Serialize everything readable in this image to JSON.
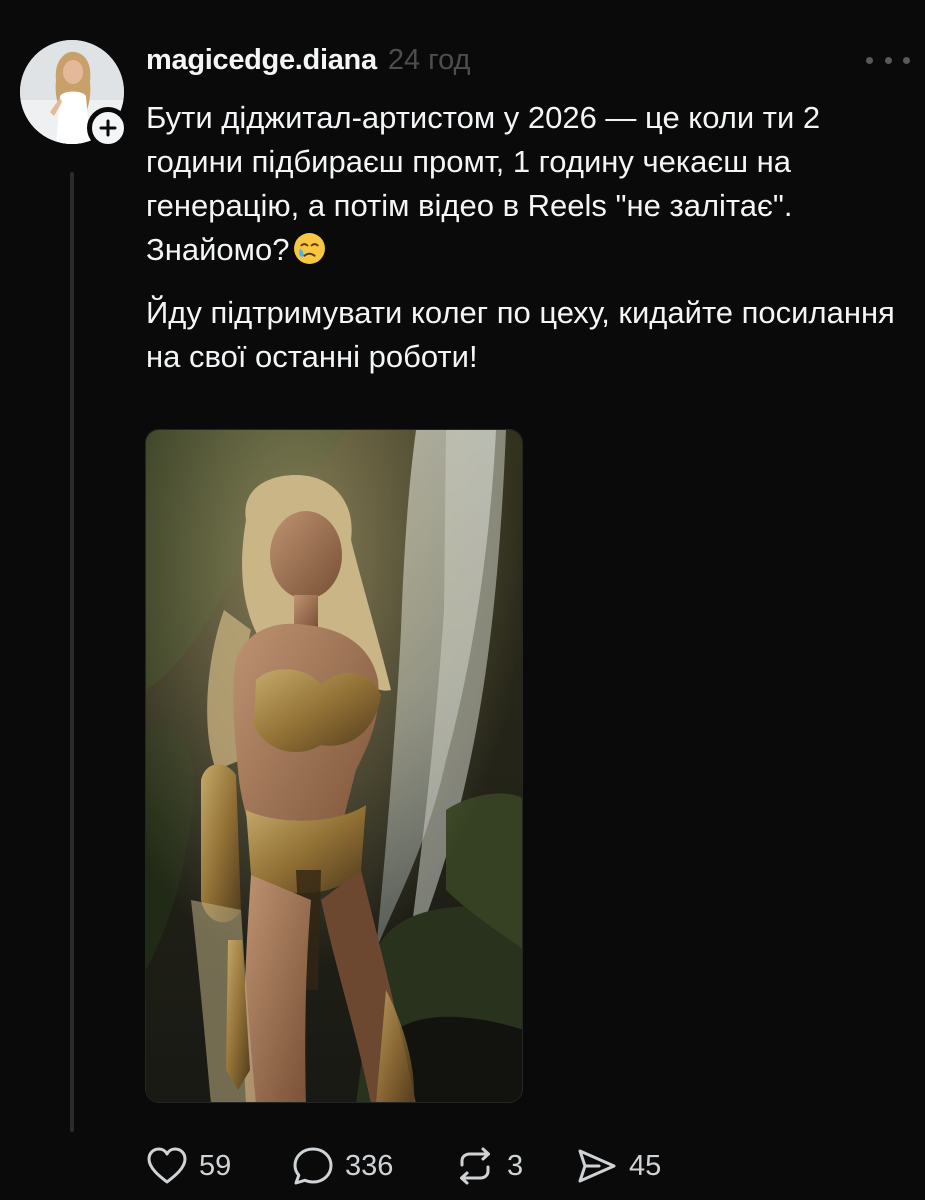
{
  "post": {
    "username": "magicedge.diana",
    "time": "24 год",
    "paragraphs": [
      "Бути діджитал-артистом у 2026 — це коли ти 2 години підбираєш промт, 1 годину чекаєш на генерацію, а потім відео в Reels \"не залітає\". Знайомо?",
      "Йду підтримувати колег по цеху, кидайте посилання на свої останні роботи!"
    ],
    "emoji": "face-holding-back-tears",
    "media_alt": "",
    "actions": {
      "likes": "59",
      "replies": "336",
      "reposts": "3",
      "shares": "45"
    }
  },
  "icons": {
    "avatar": "avatar-photo",
    "follow": "plus-icon",
    "more": "more-dots-icon",
    "like": "heart-icon",
    "reply": "comment-icon",
    "repost": "repost-icon",
    "share": "send-icon"
  },
  "colors": {
    "background": "#0a0a0a",
    "text": "#f3f5f7",
    "muted": "#4d4d4d",
    "thread_line": "#2b2b2b"
  }
}
